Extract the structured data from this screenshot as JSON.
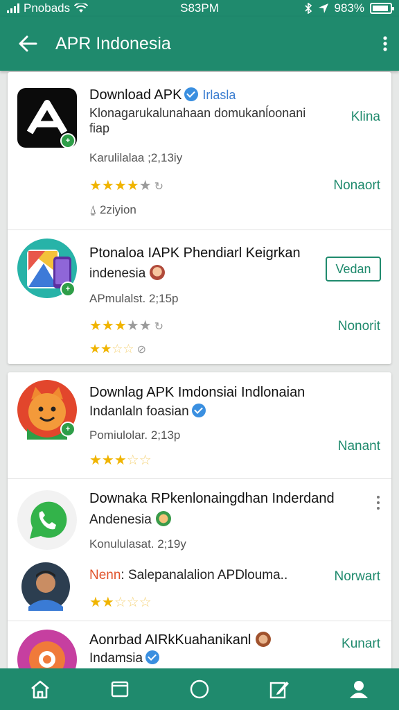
{
  "status_bar": {
    "carrier": "Pnobads",
    "time": "S83PM",
    "battery": "983%",
    "battery_level": 0.9
  },
  "app_bar": {
    "title": "APR Indonesia",
    "back_icon": "arrow-left-icon",
    "menu_icon": "more-vert-icon"
  },
  "colors": {
    "primary": "#1f8a6d",
    "star": "#f0b400",
    "verified": "#3a8fe0"
  },
  "items": [
    {
      "title": "Download APK",
      "tag": "Irlasla",
      "desc_line1": "Klonagarukalunahaan domukanĺoonani",
      "desc_line2": "fiap",
      "meta": "Karulilalaa ;2,13iy",
      "action_top": "Klina",
      "action": "Nonaort",
      "extra": "2ziyion",
      "rating": 3.5,
      "icon": "apk-logo-icon"
    },
    {
      "title": "Ptonaloa IAPK Phendiarl Keigrkan",
      "subtitle": "indenesia",
      "meta": "APmulalst. 2;15p",
      "button": "Vedan",
      "action": "Nonorit",
      "rating": 3.5,
      "rating2": 2.5,
      "icon": "maps-icon"
    },
    {
      "title": "Downlag APK Imdonsiai Indlonaian",
      "subtitle": "Indanlaln foasian",
      "meta": "Pomiulolar. 2;13p",
      "action": "Nanant",
      "rating": 3.5,
      "icon": "fox-icon"
    },
    {
      "title": "Downaka RPkenlonaingdhan Inderdand",
      "subtitle": "Andenesia",
      "meta": "Konululasat. 2;19y",
      "promo_label": "Nenn",
      "promo_text": ": Salepanalalion APDlouma..",
      "action": "Norwart",
      "rating": 2.5,
      "icon": "whatsapp-icon"
    },
    {
      "title": "Aonrbad AIRkKuahanikanl",
      "subtitle": "Indamsia",
      "action": "Kunart",
      "icon": "app-icon"
    }
  ],
  "bottom_nav": [
    "home-icon",
    "tabs-icon",
    "circle-icon",
    "edit-icon",
    "profile-icon"
  ]
}
